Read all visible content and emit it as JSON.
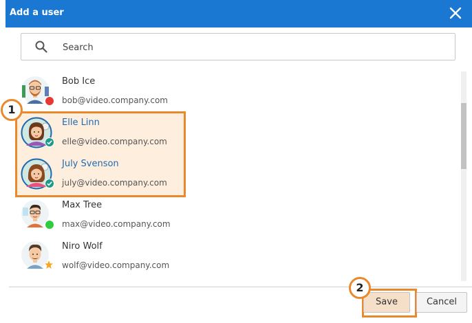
{
  "dialog": {
    "title": "Add a user"
  },
  "search": {
    "placeholder": "Search"
  },
  "users": [
    {
      "name": "Bob Ice",
      "email": "bob@video.company.com",
      "status": "busy",
      "selected": false
    },
    {
      "name": "Elle Linn",
      "email": "elle@video.company.com",
      "status": "checked",
      "selected": true
    },
    {
      "name": "July Svenson",
      "email": "july@video.company.com",
      "status": "checked",
      "selected": true
    },
    {
      "name": "Max Tree",
      "email": "max@video.company.com",
      "status": "online",
      "selected": false
    },
    {
      "name": "Niro Wolf",
      "email": "wolf@video.company.com",
      "status": "star",
      "selected": false
    }
  ],
  "markers": {
    "one": "1",
    "two": "2"
  },
  "buttons": {
    "save": "Save",
    "cancel": "Cancel"
  },
  "colors": {
    "header": "#1a78d3",
    "highlight": "#e9892b",
    "selected_bg": "#fdeede",
    "busy": "#e53935",
    "online": "#2ecc40",
    "check": "#1f9a8a",
    "star": "#f5a623"
  }
}
